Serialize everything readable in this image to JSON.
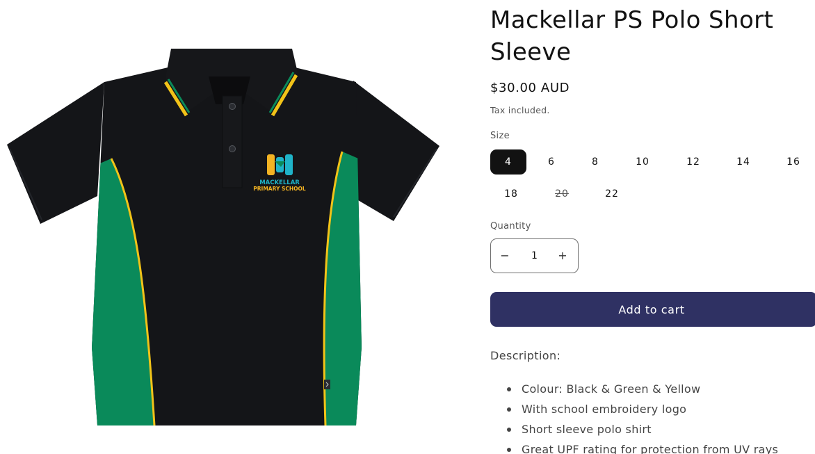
{
  "product": {
    "title": "Mackellar PS Polo Short Sleeve",
    "price": "$30.00 AUD",
    "tax_note": "Tax included.",
    "image_logo_text": {
      "line1": "MACKELLAR",
      "line2": "PRIMARY SCHOOL"
    }
  },
  "size": {
    "label": "Size",
    "selected": "4",
    "options": [
      {
        "value": "4",
        "state": "selected"
      },
      {
        "value": "6",
        "state": "available"
      },
      {
        "value": "8",
        "state": "available"
      },
      {
        "value": "10",
        "state": "available"
      },
      {
        "value": "12",
        "state": "available"
      },
      {
        "value": "14",
        "state": "available"
      },
      {
        "value": "16",
        "state": "available"
      },
      {
        "value": "18",
        "state": "available"
      },
      {
        "value": "20",
        "state": "sold-out"
      },
      {
        "value": "22",
        "state": "available"
      }
    ]
  },
  "quantity": {
    "label": "Quantity",
    "value": "1",
    "decrease_symbol": "−",
    "increase_symbol": "+"
  },
  "cart": {
    "button_label": "Add to cart"
  },
  "description": {
    "title": "Description:",
    "bullets": [
      "Colour: Black & Green & Yellow",
      "With school embroidery logo",
      "Short sleeve polo shirt",
      "Great UPF rating for protection from UV rays"
    ]
  },
  "colors": {
    "shirt_black": "#141518",
    "shirt_green": "#0a8a5a",
    "piping_yellow": "#f2c318",
    "button_primary": "#2f3163",
    "selected_chip": "#121212",
    "logo_teal": "#1fb3c8",
    "logo_yellow": "#f3b323"
  }
}
